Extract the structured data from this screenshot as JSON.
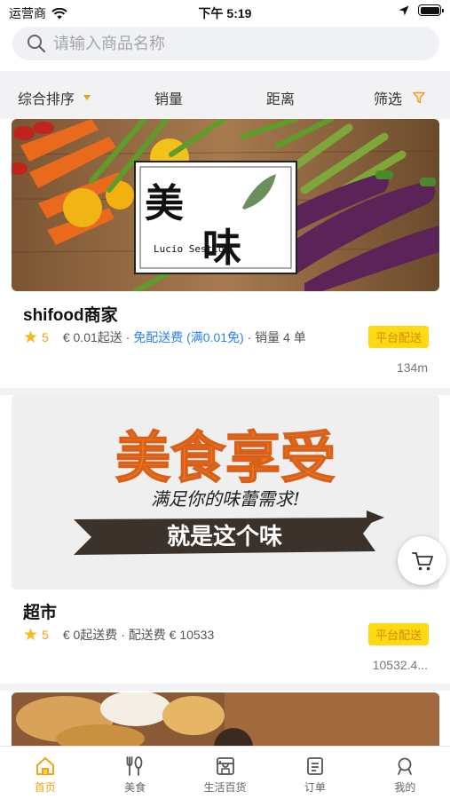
{
  "status_bar": {
    "carrier": "运营商",
    "time": "下午 5:19"
  },
  "search": {
    "placeholder": "请输入商品名称"
  },
  "filters": {
    "sort": "综合排序",
    "sales": "销量",
    "distance": "距离",
    "filter": "筛选"
  },
  "colors": {
    "accent": "#f5a20f",
    "badge_bg": "#ffda12",
    "link_blue": "#2b82f0",
    "star": "#f6b81b"
  },
  "stores": [
    {
      "name": "shifood商家",
      "rating": "5",
      "min_order": "€ 0.01起送 ·",
      "delivery_fee": "免配送费 (满0.01免)",
      "sales": "· 销量 4 单",
      "badge": "平台配送",
      "distance": "134m",
      "banner_logo_text": "美味",
      "banner_logo_sub": "Lucio Sestio"
    },
    {
      "name": "超市",
      "rating": "5",
      "min_order": "€ 0起送费 ·",
      "delivery_fee": "配送费 € 10533",
      "badge": "平台配送",
      "distance": "10532.4...",
      "banner_title": "美食享受",
      "banner_handwriting": "满足你的味蕾需求!",
      "banner_ribbon": "就是这个味"
    }
  ],
  "tabs": [
    {
      "label": "首页",
      "icon": "home-icon",
      "active": true
    },
    {
      "label": "美食",
      "icon": "utensils-icon"
    },
    {
      "label": "生活百货",
      "icon": "store-icon"
    },
    {
      "label": "订单",
      "icon": "orders-icon"
    },
    {
      "label": "我的",
      "icon": "profile-icon"
    }
  ]
}
